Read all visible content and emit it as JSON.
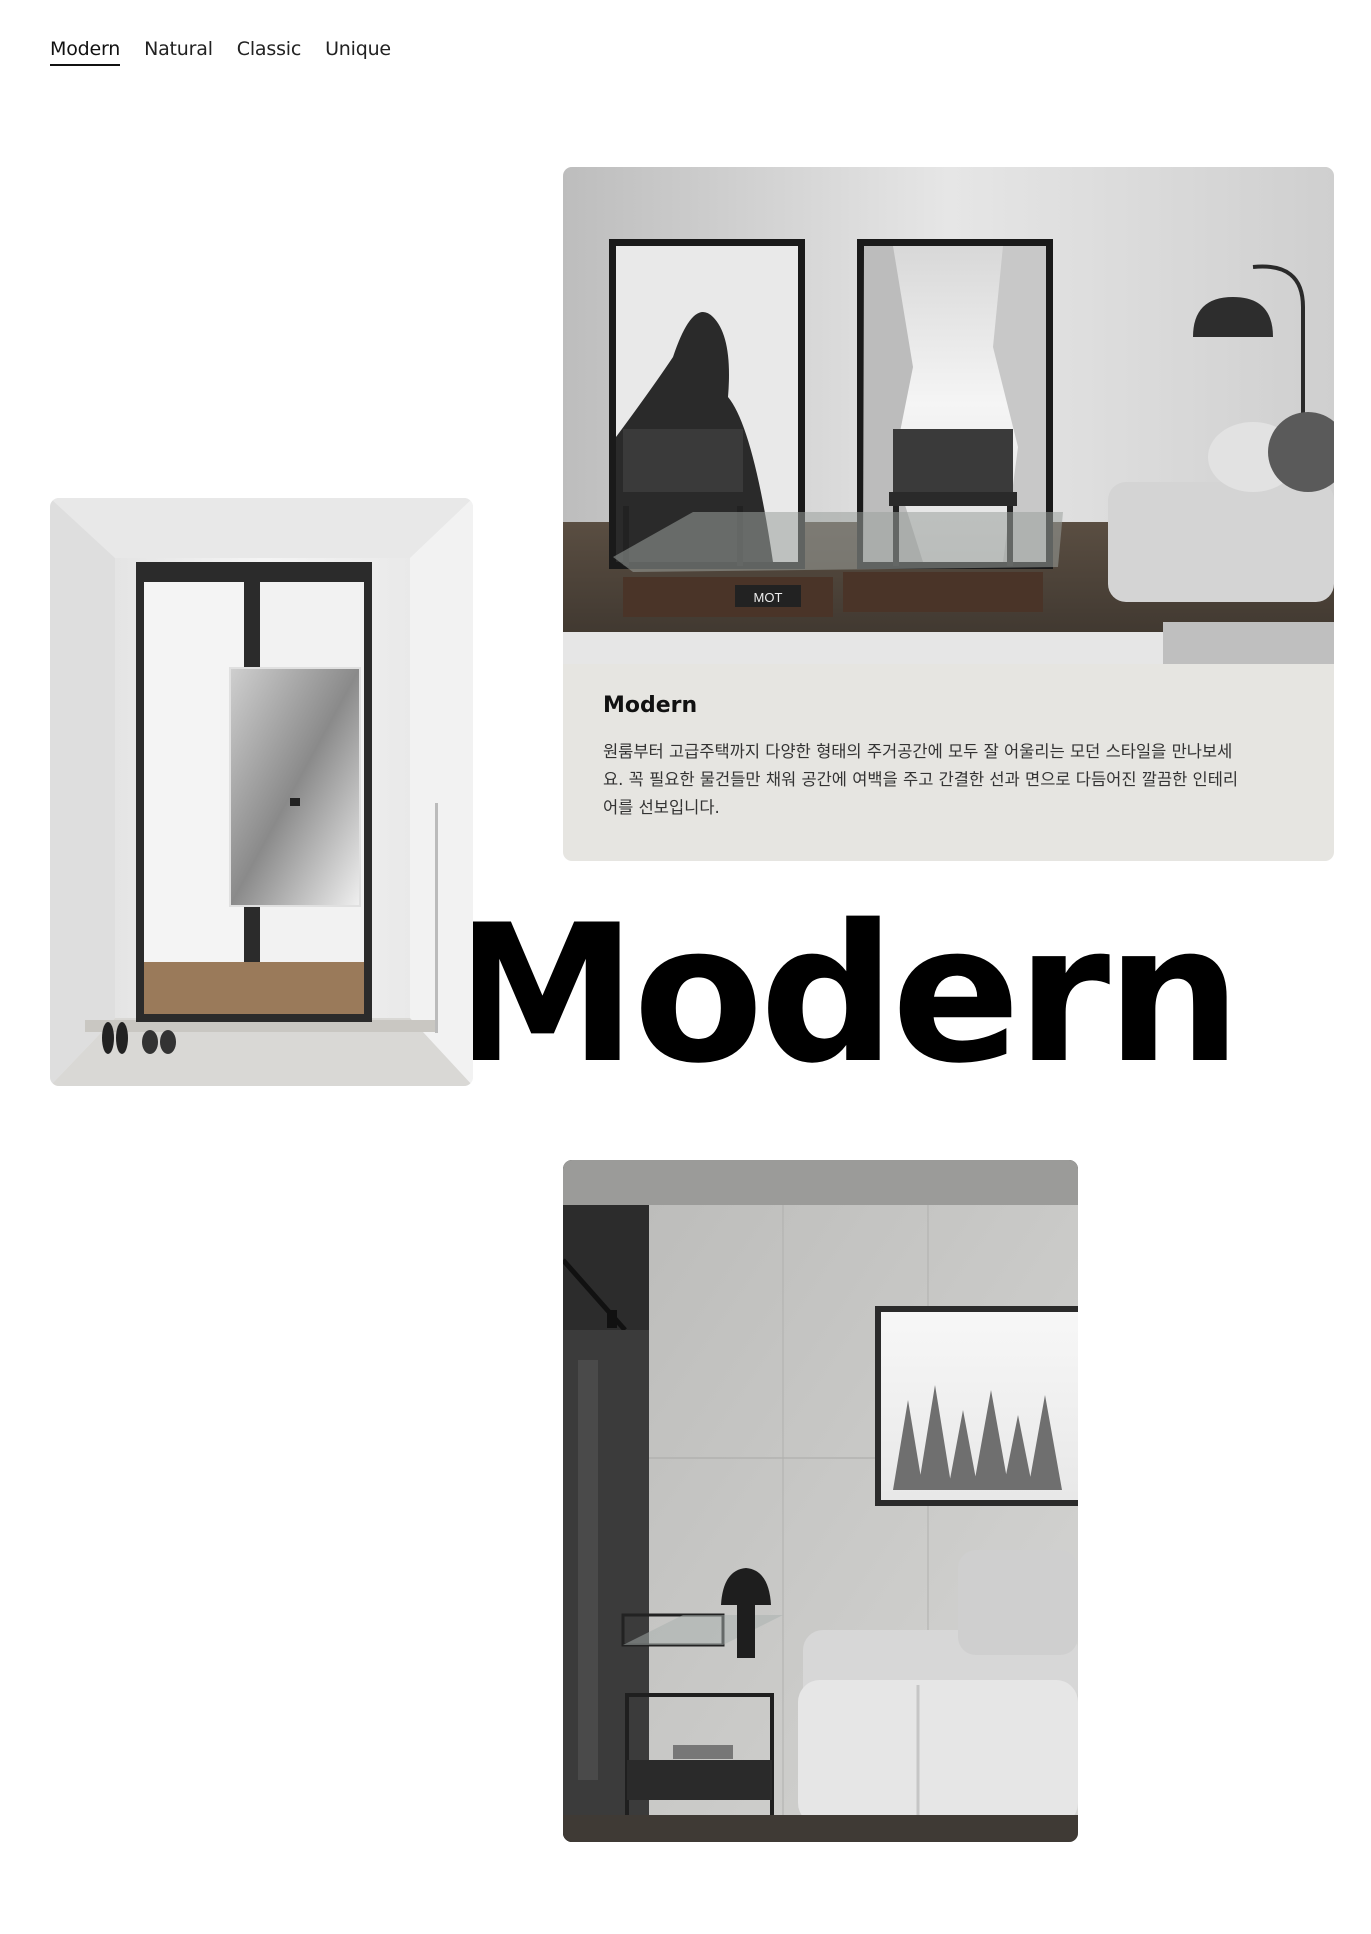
{
  "tabs": [
    {
      "label": "Modern",
      "active": true
    },
    {
      "label": "Natural",
      "active": false
    },
    {
      "label": "Classic",
      "active": false
    },
    {
      "label": "Unique",
      "active": false
    }
  ],
  "headline": "Modern",
  "feature": {
    "title": "Modern",
    "description": "원룸부터 고급주택까지 다양한 형태의 주거공간에 모두 잘 어울리는 모던 스타일을 만나보세요. 꼭 필요한 물건들만 채워 공간에 여백을 주고 간결한 선과 면으로 다듬어진 깔끔한 인테리어를 선보입니다."
  },
  "artwork": {
    "tray_book_text": "MOT"
  },
  "colors": {
    "background": "#ffffff",
    "card_background": "#e6e5e1",
    "text_primary": "#111111",
    "text_secondary": "#333333"
  }
}
